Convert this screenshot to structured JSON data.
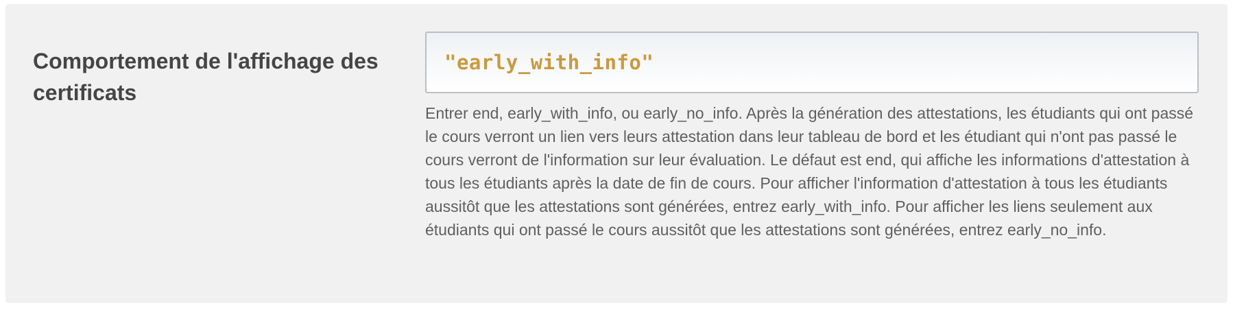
{
  "setting": {
    "label": "Comportement de l'affichage des certificats",
    "value": "\"early_with_info\"",
    "help_text": "Entrer end, early_with_info, ou early_no_info. Après la génération des attestations, les étudiants qui ont passé le cours verront un lien vers leurs attestation dans leur tableau de bord et les étudiant qui n'ont pas passé le cours verront de l'information sur leur évaluation. Le défaut est end, qui affiche les informations d'attestation à tous les étudiants après la date de fin de cours. Pour afficher l'information d'attestation à tous les étudiants aussitôt que les attestations sont générées, entrez early_with_info. Pour afficher les liens seulement aux étudiants qui ont passé le cours aussitôt que les attestations sont générées, entrez early_no_info."
  },
  "colors": {
    "panel_background": "#f1f1f1",
    "value_text": "#c99a3f",
    "label_text": "#454545",
    "help_text": "#5f5f5f",
    "field_border": "#b9bfc6"
  }
}
